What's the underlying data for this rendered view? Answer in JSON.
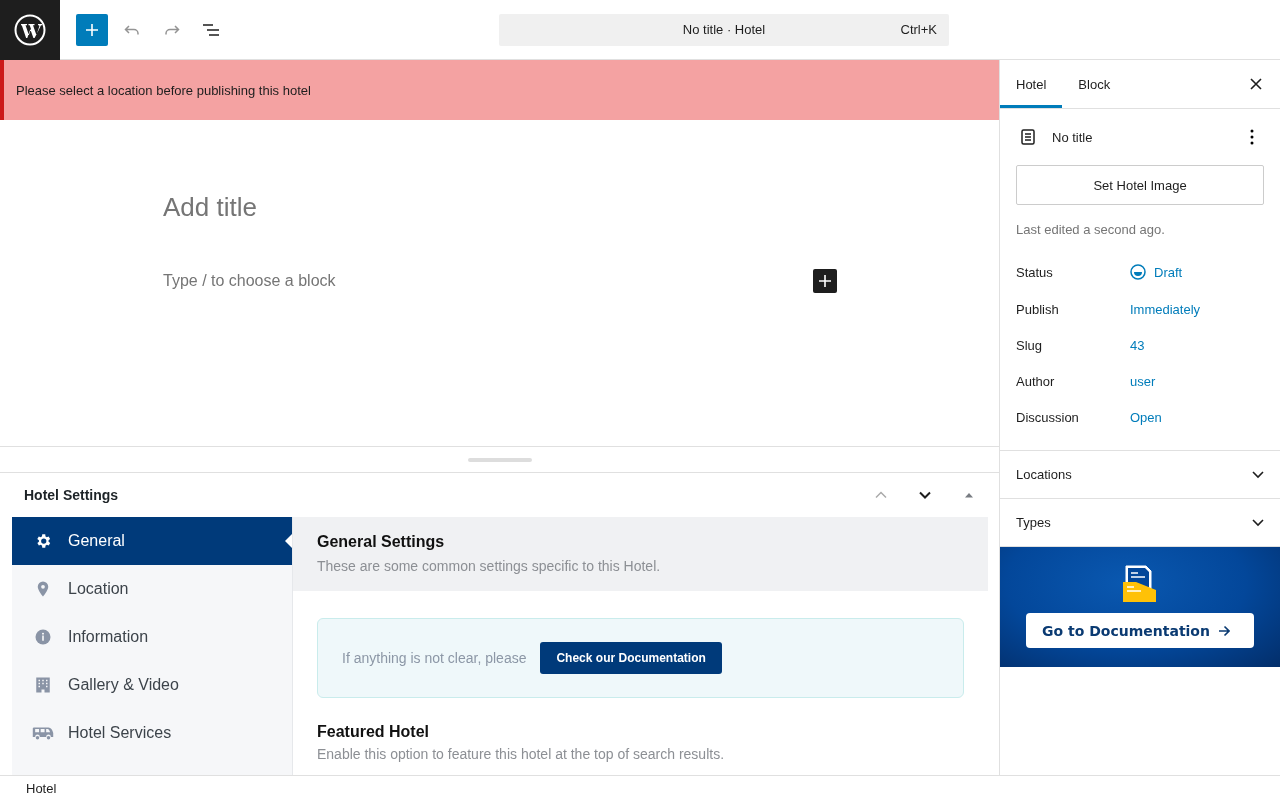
{
  "command_bar": {
    "title": "No title · Hotel",
    "shortcut": "Ctrl+K"
  },
  "notice": {
    "text": "Please select a location before publishing this hotel"
  },
  "editor": {
    "title_placeholder": "Add title",
    "block_placeholder": "Type / to choose a block"
  },
  "metabox": {
    "title": "Hotel Settings",
    "nav": [
      {
        "label": "General",
        "selected": true
      },
      {
        "label": "Location",
        "selected": false
      },
      {
        "label": "Information",
        "selected": false
      },
      {
        "label": "Gallery & Video",
        "selected": false
      },
      {
        "label": "Hotel Services",
        "selected": false
      }
    ],
    "section": {
      "title": "General Settings",
      "description": "These are some common settings specific to this Hotel."
    },
    "help": {
      "text": "If anything is not clear, please",
      "button": "Check our Documentation"
    },
    "featured": {
      "title": "Featured Hotel",
      "description": "Enable this option to feature this hotel at the top of search results."
    }
  },
  "sidebar": {
    "tabs": [
      {
        "label": "Hotel",
        "selected": true
      },
      {
        "label": "Block",
        "selected": false
      }
    ],
    "post_title": "No title",
    "image_button": "Set Hotel Image",
    "last_edited": "Last edited a second ago.",
    "rows": [
      {
        "label": "Status",
        "value": "Draft"
      },
      {
        "label": "Publish",
        "value": "Immediately"
      },
      {
        "label": "Slug",
        "value": "43"
      },
      {
        "label": "Author",
        "value": "user"
      },
      {
        "label": "Discussion",
        "value": "Open"
      }
    ],
    "panels": [
      {
        "title": "Locations",
        "expanded": false
      },
      {
        "title": "Types",
        "expanded": false
      }
    ],
    "promo": {
      "button": "Go to Documentation"
    }
  },
  "status_bar": {
    "breadcrumb": "Hotel"
  }
}
